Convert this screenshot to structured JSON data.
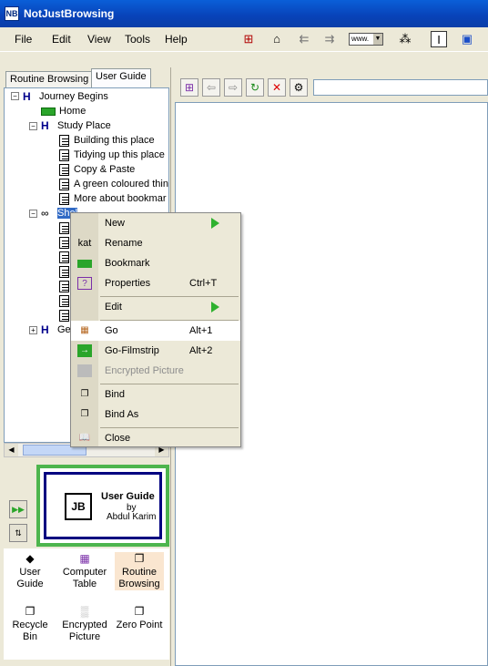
{
  "app": {
    "title": "NotJustBrowsing",
    "icon": "nb-app-icon"
  },
  "menubar": {
    "items": [
      "File",
      "Edit",
      "View",
      "Tools",
      "Help"
    ]
  },
  "toolbar": {
    "icons": [
      "tree-structure-icon",
      "home-icon",
      "back-arrow-icon",
      "forward-arrow-icon",
      "address-dropdown-icon",
      "tools-icon",
      "text-cursor-icon",
      "window-icon"
    ],
    "address_value": "www."
  },
  "tabs": [
    {
      "label": "Routine Browsing",
      "active": false
    },
    {
      "label": "User Guide",
      "active": true
    }
  ],
  "tree": {
    "root": "Journey Begins",
    "home": "Home",
    "study_place": "Study Place",
    "study_items": [
      "Building this place",
      "Tidying up this place",
      "Copy & Paste",
      "A green coloured thin",
      "More about bookmar"
    ],
    "shelf_label": "Shel",
    "ge_label": "Ge"
  },
  "context_menu": {
    "items": [
      {
        "label": "New",
        "submenu": true,
        "icon": "none"
      },
      {
        "label": "Rename",
        "icon_text": "kat"
      },
      {
        "label": "Bookmark",
        "icon": "bookmark-arrow-icon"
      },
      {
        "label": "Properties",
        "accel": "Ctrl+T",
        "icon": "properties-icon"
      },
      {
        "label": "Edit",
        "submenu": true
      },
      {
        "label": "Go",
        "accel": "Alt+1",
        "icon": "go-grid-icon",
        "highlighted": true
      },
      {
        "label": "Go-Filmstrip",
        "accel": "Alt+2",
        "icon": "filmstrip-icon"
      },
      {
        "label": "Encrypted Picture",
        "disabled": true,
        "icon": "encrypted-picture-icon"
      },
      {
        "label": "Bind",
        "icon": "bind-icon"
      },
      {
        "label": "Bind As",
        "icon": "bind-as-icon"
      },
      {
        "label": "Close",
        "icon": "close-book-icon"
      }
    ]
  },
  "guide_card": {
    "logo_text": "JB",
    "title": "User Guide",
    "by": "by",
    "author": "Abdul Karim"
  },
  "shortcuts": [
    {
      "label": "User Guide",
      "icon": "diamond-icon"
    },
    {
      "label": "Computer Table",
      "icon": "computer-table-icon"
    },
    {
      "label": "Routine Browsing",
      "icon": "routine-icon",
      "highlighted": true
    },
    {
      "label": "Recycle Bin",
      "icon": "recycle-icon"
    },
    {
      "label": "Encrypted Picture",
      "icon": "encrypted-icon"
    },
    {
      "label": "Zero Point",
      "icon": "zero-point-icon"
    }
  ],
  "colors": {
    "titlebar": "#0842b8",
    "selection": "#316ac5",
    "green_accent": "#4db54d"
  }
}
